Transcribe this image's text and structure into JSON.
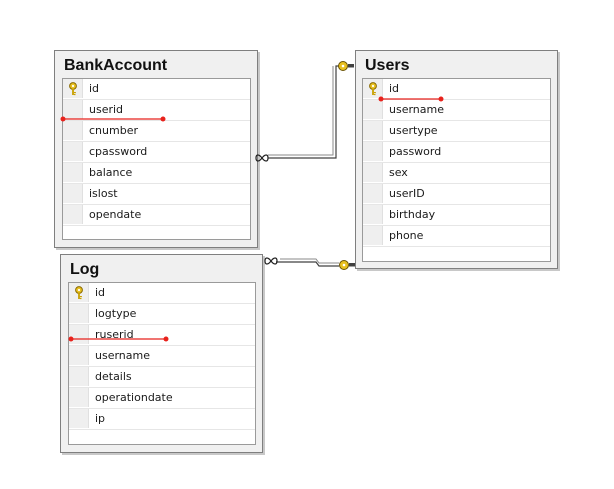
{
  "tables": {
    "bankaccount": {
      "title": "BankAccount",
      "columns": [
        "id",
        "userid",
        "cnumber",
        "cpassword",
        "balance",
        "islost",
        "opendate"
      ],
      "primary_key": "id"
    },
    "users": {
      "title": "Users",
      "columns": [
        "id",
        "username",
        "usertype",
        "password",
        "sex",
        "userID",
        "birthday",
        "phone"
      ],
      "primary_key": "id"
    },
    "log": {
      "title": "Log",
      "columns": [
        "id",
        "logtype",
        "ruserid",
        "username",
        "details",
        "operationdate",
        "ip"
      ],
      "primary_key": "id"
    }
  },
  "relationships": [
    {
      "from": "BankAccount.userid",
      "to": "Users.id",
      "many_end": "BankAccount",
      "one_end": "Users"
    },
    {
      "from": "Log.ruserid",
      "to": "Users.id",
      "many_end": "Log",
      "one_end": "Users"
    }
  ],
  "colors": {
    "highlight_line": "#e8221c",
    "key_icon": "#e8c020",
    "connector": "#404040"
  },
  "icons": [
    "primary-key-icon",
    "infinity-icon",
    "key-end-icon"
  ]
}
